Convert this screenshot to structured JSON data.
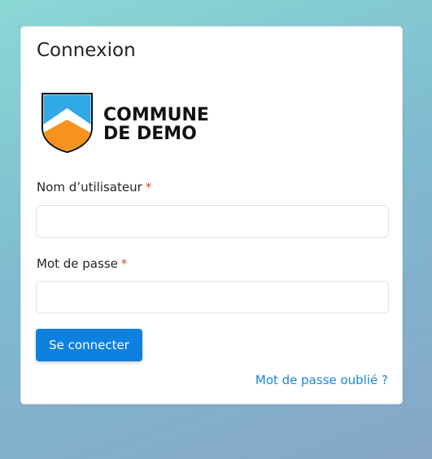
{
  "login": {
    "title": "Connexion",
    "logo": {
      "line1": "COMMUNE",
      "line2": "DE DEMO",
      "colors": {
        "shield_blue": "#31a9e6",
        "shield_orange": "#f7921e",
        "shield_outline": "#111111"
      }
    },
    "username": {
      "label": "Nom d’utilisateur",
      "required_mark": "*",
      "value": "",
      "placeholder": ""
    },
    "password": {
      "label": "Mot de passe",
      "required_mark": "*",
      "value": "",
      "placeholder": ""
    },
    "submit_label": "Se connecter",
    "forgot_label": "Mot de passe oublié ?"
  },
  "colors": {
    "primary": "#0d80e0",
    "link": "#1a86d6",
    "required": "#d43f3a"
  }
}
